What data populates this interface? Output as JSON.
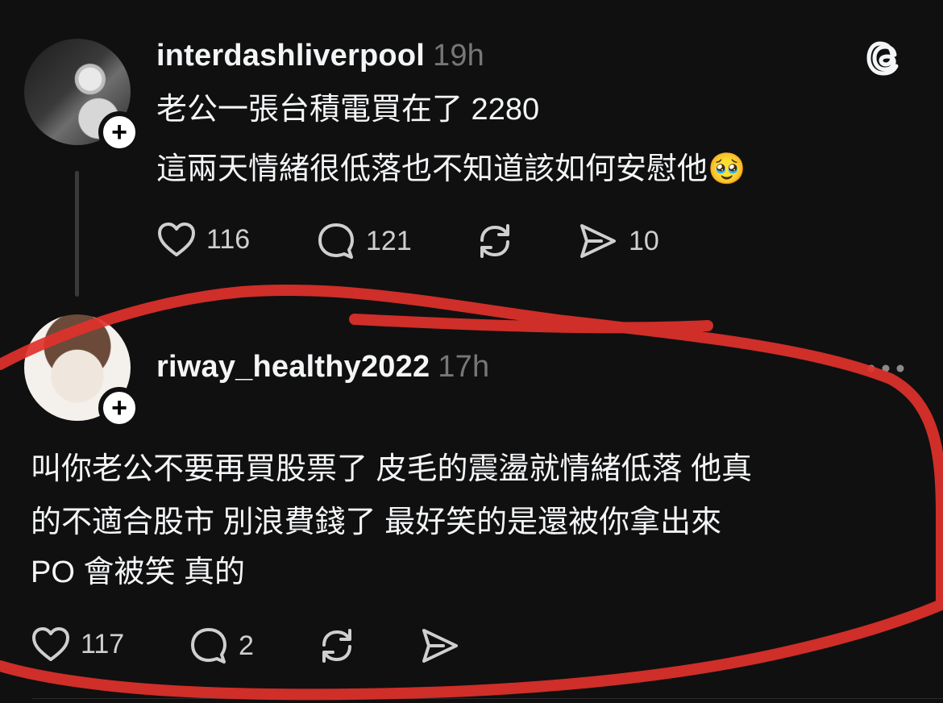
{
  "colors": {
    "background": "#101010",
    "text": "#f3f5f7",
    "secondary_text": "#777777",
    "annotation": "#e0312b"
  },
  "post": {
    "username": "interdashliverpool",
    "time": "19h",
    "lines": [
      "老公一張台積電買在了 2280",
      "這兩天情緒很低落也不知道該如何安慰他🥹"
    ],
    "likes": "116",
    "comments": "121",
    "shares": "10",
    "app_icon": "threads-logo-icon"
  },
  "reply": {
    "username": "riway_healthy2022",
    "time": "17h",
    "lines": [
      "叫你老公不要再買股票了 皮毛的震盪就情緒低落 他真",
      "的不適合股市 別浪費錢了 最好笑的是還被你拿出來",
      "PO 會被笑 真的"
    ],
    "likes": "117",
    "comments": "2"
  }
}
